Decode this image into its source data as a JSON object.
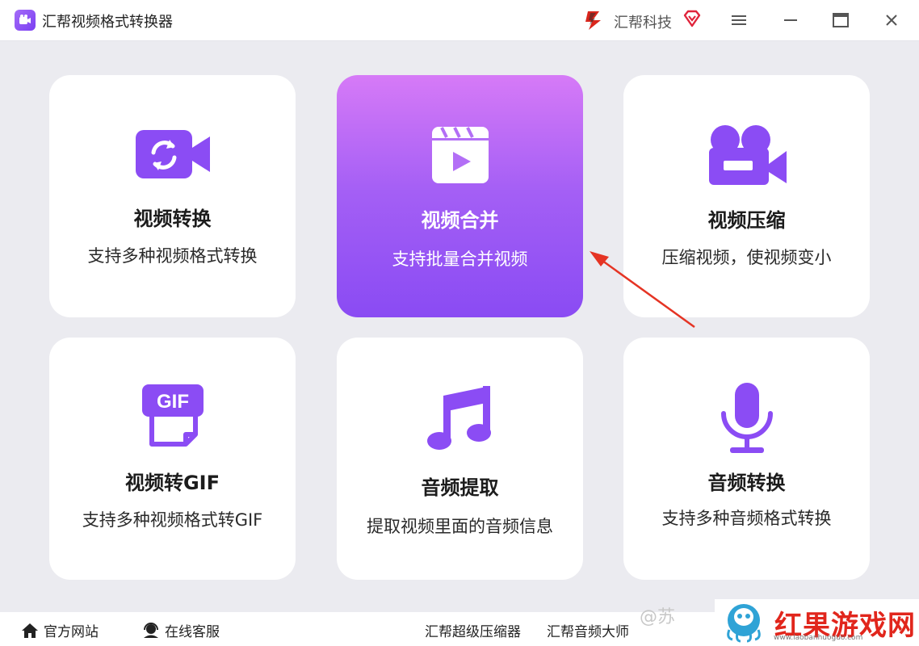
{
  "titlebar": {
    "app_title": "汇帮视频格式转换器",
    "brand_name": "汇帮科技",
    "menu_icon": "hamburger-menu-icon",
    "maximize_icon": "maximize-icon",
    "close_icon": "close-icon"
  },
  "cards": [
    {
      "title": "视频转换",
      "desc": "支持多种视频格式转换",
      "icon": "video-convert-icon"
    },
    {
      "title": "视频合并",
      "desc": "支持批量合并视频",
      "icon": "clapperboard-play-icon",
      "active": true
    },
    {
      "title": "视频压缩",
      "desc": "压缩视频，使视频变小",
      "icon": "video-camera-icon"
    },
    {
      "title": "视频转GIF",
      "desc": "支持多种视频格式转GIF",
      "icon": "gif-file-icon"
    },
    {
      "title": "音频提取",
      "desc": "提取视频里面的音频信息",
      "icon": "music-note-icon"
    },
    {
      "title": "音频转换",
      "desc": "支持多种音频格式转换",
      "icon": "microphone-icon"
    }
  ],
  "bottombar": {
    "website": "官方网站",
    "support": "在线客服",
    "compressor": "汇帮超级压缩器",
    "audio_master": "汇帮音频大师"
  },
  "watermark": {
    "left_text": "@苏",
    "brand": "红果游戏网",
    "url": "www.laobanhuoguo.com"
  },
  "colors": {
    "accent": "#8b4cf4",
    "accent_light": "#d67af7",
    "annotation_arrow": "#e53424",
    "background": "#ebebf0"
  }
}
